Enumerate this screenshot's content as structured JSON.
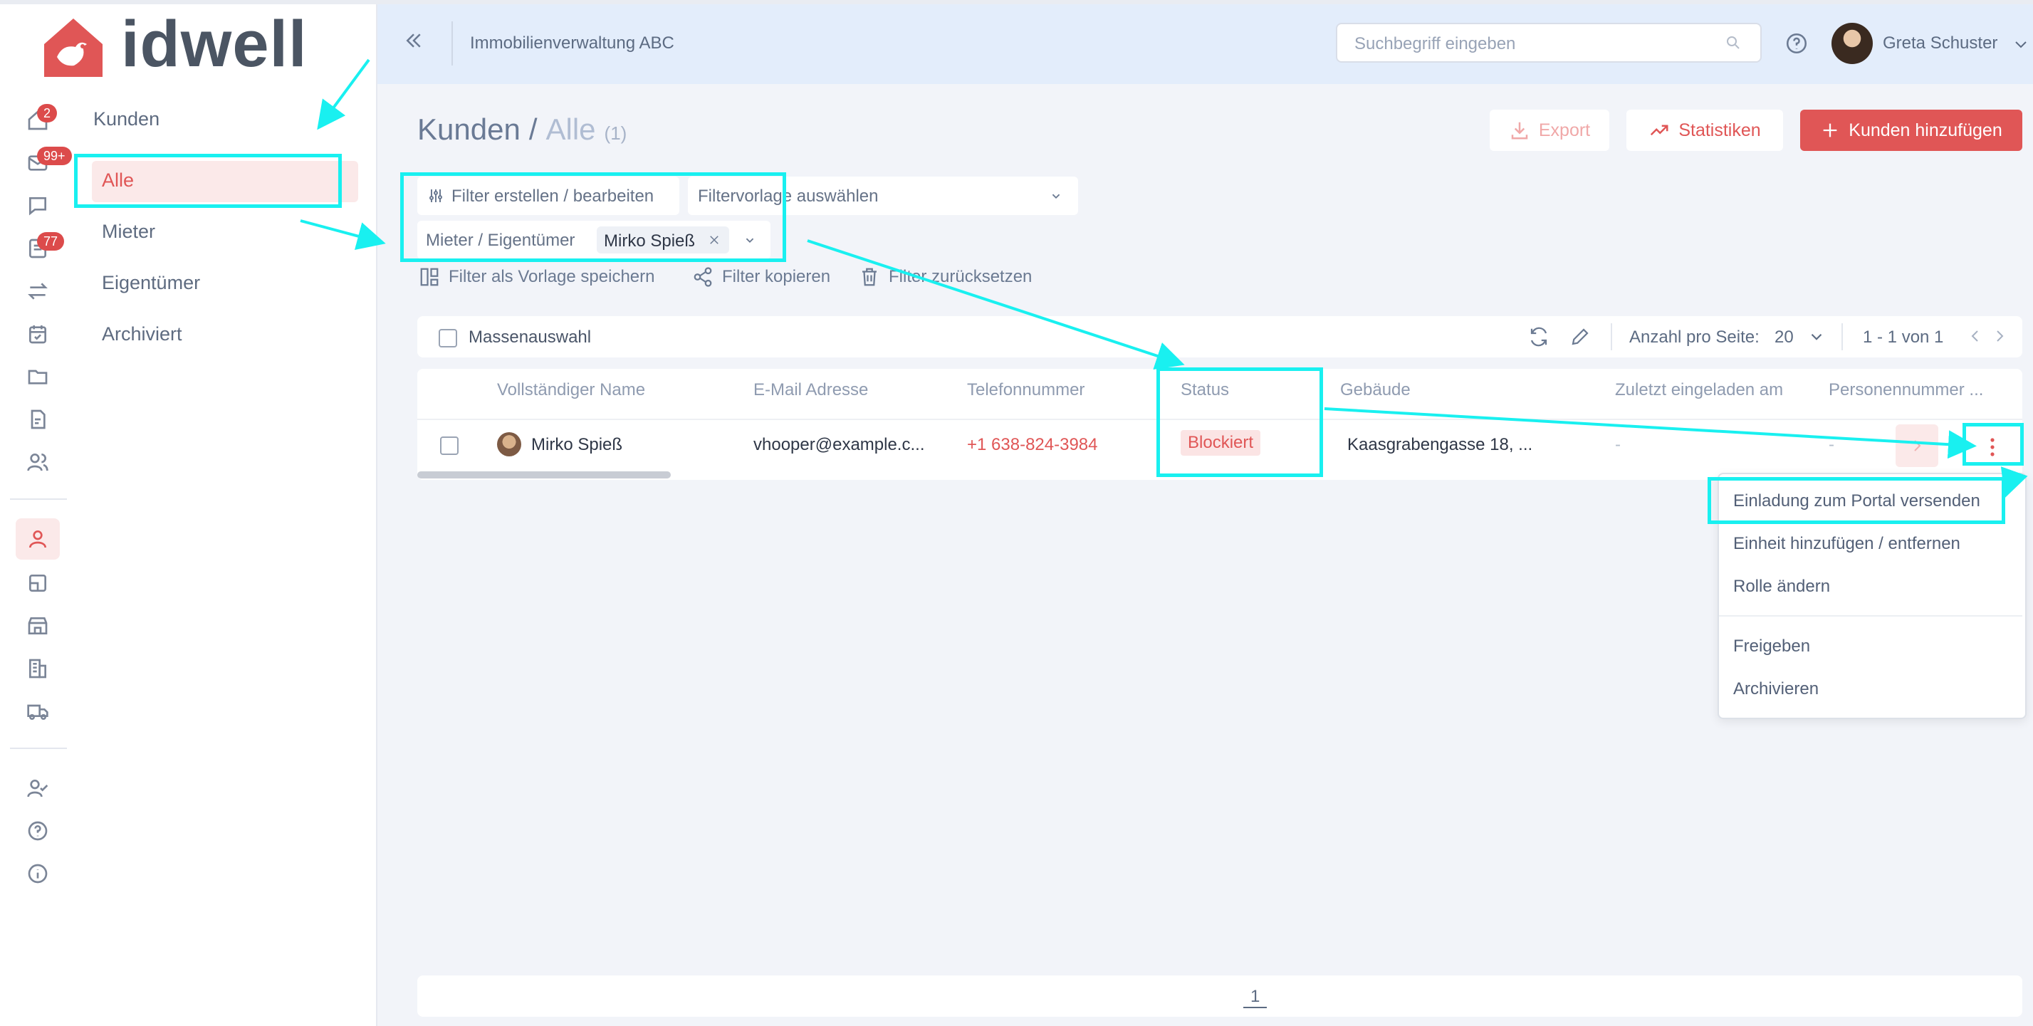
{
  "app": {
    "logo_text": "idwell",
    "brand_color": "#e05656"
  },
  "rail": {
    "badges": {
      "home": "2",
      "mail": "99+",
      "tasks": "77"
    },
    "icons": [
      "home-icon",
      "mail-icon",
      "chat-icon",
      "tasks-icon",
      "transfer-icon",
      "calendar-icon",
      "folder-icon",
      "document-icon",
      "users-icon",
      "person-icon",
      "notes-icon",
      "store-icon",
      "building-icon",
      "truck-icon",
      "user-check-icon",
      "help-icon",
      "info-icon"
    ]
  },
  "sidebar": {
    "title": "Kunden",
    "items": [
      {
        "label": "Alle"
      },
      {
        "label": "Mieter"
      },
      {
        "label": "Eigentümer"
      },
      {
        "label": "Archiviert"
      }
    ]
  },
  "header": {
    "company": "Immobilienverwaltung ABC",
    "search_placeholder": "Suchbegriff eingeben",
    "user_name": "Greta Schuster"
  },
  "page": {
    "title_main": "Kunden",
    "title_sep": "/",
    "title_sub": "Alle",
    "count": "(1)",
    "export_label": "Export",
    "stats_label": "Statistiken",
    "add_label": "Kunden hinzufügen"
  },
  "filters": {
    "edit_label": "Filter erstellen / bearbeiten",
    "template_placeholder": "Filtervorlage auswählen",
    "role_label": "Mieter / Eigentümer",
    "role_value": "Mirko Spieß",
    "save_template": "Filter als Vorlage speichern",
    "copy": "Filter kopieren",
    "reset": "Filter zurücksetzen"
  },
  "toolbar": {
    "bulk_select": "Massenauswahl",
    "per_page_label": "Anzahl pro Seite:",
    "per_page_value": "20",
    "pagination": "1 - 1 von 1"
  },
  "table": {
    "columns": [
      "Vollständiger Name",
      "E-Mail Adresse",
      "Telefonnummer",
      "Status",
      "Gebäude",
      "Zuletzt eingeladen am",
      "Personennummer ..."
    ],
    "rows": [
      {
        "name": "Mirko Spieß",
        "email": "vhooper@example.c...",
        "phone": "+1 638-824-3984",
        "status": "Blockiert",
        "building": "Kaasgrabengasse 18, ...",
        "last_invited": "-",
        "person_no": "-"
      }
    ]
  },
  "context_menu": {
    "items": [
      "Einladung zum Portal versenden",
      "Einheit hinzufügen / entfernen",
      "Rolle ändern",
      "Freigeben",
      "Archivieren"
    ]
  },
  "footer": {
    "page": "1"
  }
}
